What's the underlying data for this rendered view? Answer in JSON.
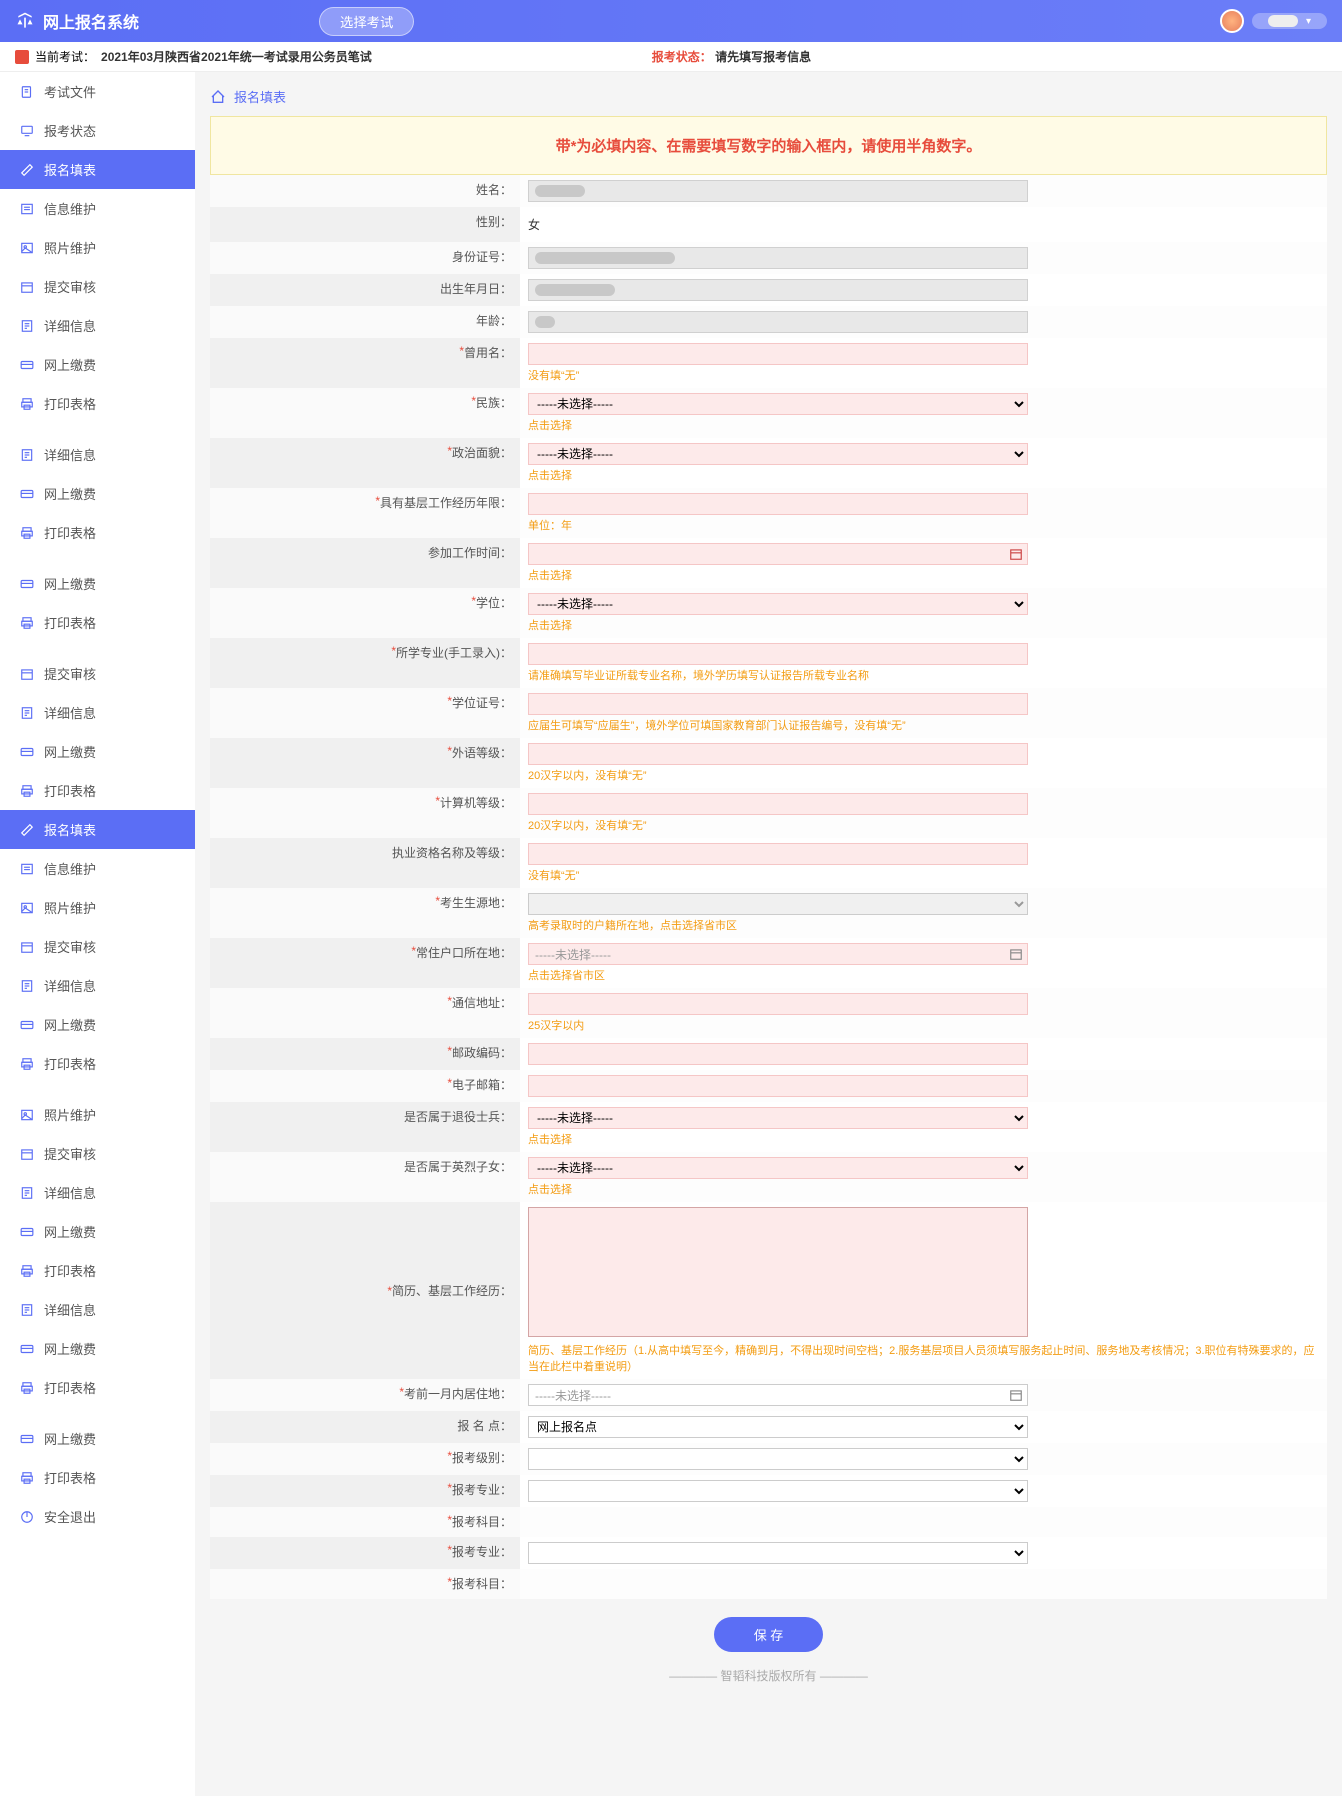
{
  "header": {
    "title": "网上报名系统",
    "select_exam": "选择考试"
  },
  "subheader": {
    "prefix": "当前考试：",
    "exam": "2021年03月陕西省2021年统一考试录用公务员笔试",
    "status_label": "报考状态：",
    "status_text": "请先填写报考信息"
  },
  "nav": [
    {
      "label": "考试文件",
      "icon": "file"
    },
    {
      "label": "报考状态",
      "icon": "monitor"
    },
    {
      "label": "报名填表",
      "icon": "edit",
      "active": true
    },
    {
      "label": "信息维护",
      "icon": "list"
    },
    {
      "label": "照片维护",
      "icon": "image"
    },
    {
      "label": "提交审核",
      "icon": "calendar"
    },
    {
      "label": "详细信息",
      "icon": "detail"
    },
    {
      "label": "网上缴费",
      "icon": "card"
    },
    {
      "label": "打印表格",
      "icon": "print"
    },
    {
      "label": "",
      "divider": true
    },
    {
      "label": "详细信息",
      "icon": "detail"
    },
    {
      "label": "网上缴费",
      "icon": "card"
    },
    {
      "label": "打印表格",
      "icon": "print"
    },
    {
      "label": "",
      "divider": true
    },
    {
      "label": "网上缴费",
      "icon": "card"
    },
    {
      "label": "打印表格",
      "icon": "print"
    },
    {
      "label": "",
      "divider": true
    },
    {
      "label": "提交审核",
      "icon": "calendar"
    },
    {
      "label": "详细信息",
      "icon": "detail"
    },
    {
      "label": "网上缴费",
      "icon": "card"
    },
    {
      "label": "打印表格",
      "icon": "print"
    },
    {
      "label": "报名填表",
      "icon": "edit",
      "highlight": true
    },
    {
      "label": "信息维护",
      "icon": "list"
    },
    {
      "label": "照片维护",
      "icon": "image"
    },
    {
      "label": "提交审核",
      "icon": "calendar"
    },
    {
      "label": "详细信息",
      "icon": "detail"
    },
    {
      "label": "网上缴费",
      "icon": "card"
    },
    {
      "label": "打印表格",
      "icon": "print"
    },
    {
      "label": "",
      "divider": true
    },
    {
      "label": "照片维护",
      "icon": "image"
    },
    {
      "label": "提交审核",
      "icon": "calendar"
    },
    {
      "label": "详细信息",
      "icon": "detail"
    },
    {
      "label": "网上缴费",
      "icon": "card"
    },
    {
      "label": "打印表格",
      "icon": "print"
    },
    {
      "label": "详细信息",
      "icon": "detail"
    },
    {
      "label": "网上缴费",
      "icon": "card"
    },
    {
      "label": "打印表格",
      "icon": "print"
    },
    {
      "label": "",
      "divider": true
    },
    {
      "label": "网上缴费",
      "icon": "card"
    },
    {
      "label": "打印表格",
      "icon": "print"
    },
    {
      "label": "安全退出",
      "icon": "power"
    }
  ],
  "breadcrumb": "报名填表",
  "notice": "带*为必填内容、在需要填写数字的输入框内，请使用半角数字。",
  "fields": {
    "name": {
      "label": "姓名：",
      "readonly": true
    },
    "gender": {
      "label": "性别：",
      "value": "女"
    },
    "idcard": {
      "label": "身份证号：",
      "readonly": true
    },
    "birthdate": {
      "label": "出生年月日：",
      "readonly": true
    },
    "age": {
      "label": "年龄：",
      "readonly": true
    },
    "former_name": {
      "label": "曾用名：",
      "required": true,
      "hint": "没有填“无”"
    },
    "ethnicity": {
      "label": "民族：",
      "required": true,
      "select": "-----未选择-----",
      "hint": "点击选择"
    },
    "political": {
      "label": "政治面貌：",
      "required": true,
      "select": "-----未选择-----",
      "hint": "点击选择"
    },
    "work_years": {
      "label": "具有基层工作经历年限：",
      "required": true,
      "hint": "单位：年"
    },
    "join_work": {
      "label": "参加工作时间：",
      "date": true,
      "hint": "点击选择"
    },
    "degree": {
      "label": "学位：",
      "required": true,
      "select": "-----未选择-----",
      "hint": "点击选择"
    },
    "major": {
      "label": "所学专业(手工录入)：",
      "required": true,
      "hint": "请准确填写毕业证所载专业名称，境外学历填写认证报告所载专业名称"
    },
    "degree_cert": {
      "label": "学位证号：",
      "required": true,
      "hint": "应届生可填写“应届生”，境外学位可填国家教育部门认证报告编号，没有填“无”"
    },
    "foreign_lang": {
      "label": "外语等级：",
      "required": true,
      "hint": "20汉字以内，没有填“无”"
    },
    "computer": {
      "label": "计算机等级：",
      "required": true,
      "hint": "20汉字以内，没有填“无”"
    },
    "qualification": {
      "label": "执业资格名称及等级：",
      "hint": "没有填“无”"
    },
    "exam_origin": {
      "label": "考生生源地：",
      "required": true,
      "select_disabled": true,
      "hint": "高考录取时的户籍所在地，点击选择省市区"
    },
    "residence": {
      "label": "常住户口所在地：",
      "required": true,
      "select": "-----未选择-----",
      "date_icon": true,
      "hint": "点击选择省市区"
    },
    "address": {
      "label": "通信地址：",
      "required": true,
      "hint": "25汉字以内"
    },
    "postcode": {
      "label": "邮政编码：",
      "required": true
    },
    "email": {
      "label": "电子邮箱：",
      "required": true
    },
    "retired": {
      "label": "是否属于退役士兵：",
      "select": "-----未选择-----",
      "hint": "点击选择"
    },
    "martyr": {
      "label": "是否属于英烈子女：",
      "select": "-----未选择-----",
      "hint": "点击选择"
    },
    "resume": {
      "label": "简历、基层工作经历：",
      "required": true,
      "textarea": true,
      "hint": "简历、基层工作经历（1.从高中填写至今，精确到月，不得出现时间空档；2.服务基层项目人员须填写服务起止时间、服务地及考核情况；3.职位有特殊要求的，应当在此栏中着重说明）"
    },
    "last_month_addr": {
      "label": "考前一月内居住地：",
      "required": true,
      "select": "-----未选择-----",
      "normal": true,
      "date_icon": true
    },
    "exam_point": {
      "label": "报 名 点：",
      "select": "网上报名点",
      "normal": true
    },
    "exam_level": {
      "label": "报考级别：",
      "required": true,
      "select": "",
      "normal": true
    },
    "exam_major1": {
      "label": "报考专业：",
      "required": true,
      "select": "",
      "normal": true
    },
    "exam_subj1": {
      "label": "报考科目：",
      "required": true
    },
    "exam_major2": {
      "label": "报考专业：",
      "required": true,
      "select": "",
      "normal": true
    },
    "exam_subj2": {
      "label": "报考科目：",
      "required": true
    }
  },
  "save_button": "保 存",
  "footer": "智韬科技版权所有"
}
